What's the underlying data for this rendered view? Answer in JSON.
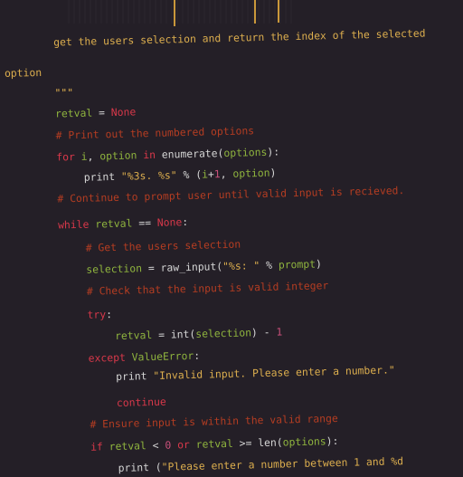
{
  "colors": {
    "background": "#241f27",
    "string": "#dcae4e",
    "name": "#8fb43e",
    "keyword": "#d8384a",
    "comment": "#b53d22",
    "plain": "#d6d6d6",
    "number": "#c8507a"
  },
  "code": {
    "lines": [
      {
        "indent": 0,
        "tokens": [
          {
            "t": "get the users selection and return the index of the selected",
            "c": "string"
          }
        ]
      },
      {
        "indent": -1,
        "tokens": [
          {
            "t": "option",
            "c": "string"
          }
        ]
      },
      {
        "indent": 0,
        "tokens": [
          {
            "t": "\"\"\"",
            "c": "string"
          }
        ]
      },
      {
        "indent": 0,
        "tokens": [
          {
            "t": "retval",
            "c": "name"
          },
          {
            "t": " = ",
            "c": "plain"
          },
          {
            "t": "None",
            "c": "keyword"
          }
        ]
      },
      {
        "indent": 0,
        "tokens": [
          {
            "t": "# Print out the numbered options",
            "c": "comment"
          }
        ]
      },
      {
        "indent": 0,
        "tokens": [
          {
            "t": "for ",
            "c": "keyword"
          },
          {
            "t": "i",
            "c": "name"
          },
          {
            "t": ", ",
            "c": "plain"
          },
          {
            "t": "option",
            "c": "name"
          },
          {
            "t": " in ",
            "c": "keyword"
          },
          {
            "t": "enumerate(",
            "c": "plain"
          },
          {
            "t": "options",
            "c": "name"
          },
          {
            "t": "):",
            "c": "plain"
          }
        ]
      },
      {
        "indent": 1,
        "tokens": [
          {
            "t": "print ",
            "c": "plain"
          },
          {
            "t": "\"%3s. %s\"",
            "c": "string"
          },
          {
            "t": " % (",
            "c": "plain"
          },
          {
            "t": "i",
            "c": "name"
          },
          {
            "t": "+",
            "c": "plain"
          },
          {
            "t": "1",
            "c": "number"
          },
          {
            "t": ", ",
            "c": "plain"
          },
          {
            "t": "option",
            "c": "name"
          },
          {
            "t": ")",
            "c": "plain"
          }
        ]
      },
      {
        "indent": 0,
        "tokens": [
          {
            "t": "# Continue to prompt user until valid input is recieved.",
            "c": "comment"
          }
        ]
      },
      {
        "indent": 0,
        "tokens": [
          {
            "t": "while ",
            "c": "keyword"
          },
          {
            "t": "retval",
            "c": "name"
          },
          {
            "t": " == ",
            "c": "plain"
          },
          {
            "t": "None",
            "c": "keyword"
          },
          {
            "t": ":",
            "c": "plain"
          }
        ]
      },
      {
        "indent": 1,
        "tokens": [
          {
            "t": "# Get the users selection",
            "c": "comment"
          }
        ]
      },
      {
        "indent": 1,
        "tokens": [
          {
            "t": "selection",
            "c": "name"
          },
          {
            "t": " = raw_input(",
            "c": "plain"
          },
          {
            "t": "\"%s: \"",
            "c": "string"
          },
          {
            "t": " % ",
            "c": "plain"
          },
          {
            "t": "prompt",
            "c": "name"
          },
          {
            "t": ")",
            "c": "plain"
          }
        ]
      },
      {
        "indent": 1,
        "tokens": [
          {
            "t": "# Check that the input is valid integer",
            "c": "comment"
          }
        ]
      },
      {
        "indent": 1,
        "tokens": [
          {
            "t": "try",
            "c": "keyword"
          },
          {
            "t": ":",
            "c": "plain"
          }
        ]
      },
      {
        "indent": 2,
        "tokens": [
          {
            "t": "retval",
            "c": "name"
          },
          {
            "t": " = int(",
            "c": "plain"
          },
          {
            "t": "selection",
            "c": "name"
          },
          {
            "t": ") - ",
            "c": "plain"
          },
          {
            "t": "1",
            "c": "number"
          }
        ]
      },
      {
        "indent": 1,
        "tokens": [
          {
            "t": "except ",
            "c": "keyword"
          },
          {
            "t": "ValueError",
            "c": "name"
          },
          {
            "t": ":",
            "c": "plain"
          }
        ]
      },
      {
        "indent": 2,
        "tokens": [
          {
            "t": "print ",
            "c": "plain"
          },
          {
            "t": "\"Invalid input. Please enter a number.\"",
            "c": "string"
          }
        ]
      },
      {
        "indent": 2,
        "tokens": [
          {
            "t": "continue",
            "c": "keyword"
          }
        ]
      },
      {
        "indent": 1,
        "tokens": [
          {
            "t": "# Ensure input is within the valid range",
            "c": "comment"
          }
        ]
      },
      {
        "indent": 1,
        "tokens": [
          {
            "t": "if ",
            "c": "keyword"
          },
          {
            "t": "retval",
            "c": "name"
          },
          {
            "t": " < ",
            "c": "plain"
          },
          {
            "t": "0",
            "c": "number"
          },
          {
            "t": " or ",
            "c": "keyword"
          },
          {
            "t": "retval",
            "c": "name"
          },
          {
            "t": " >= len(",
            "c": "plain"
          },
          {
            "t": "options",
            "c": "name"
          },
          {
            "t": "):",
            "c": "plain"
          }
        ]
      },
      {
        "indent": 2,
        "tokens": [
          {
            "t": "print (",
            "c": "plain"
          },
          {
            "t": "\"Please enter a number between 1 and %d",
            "c": "string"
          }
        ]
      }
    ]
  }
}
